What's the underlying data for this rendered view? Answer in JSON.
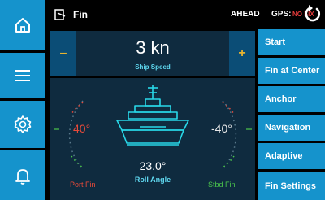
{
  "header": {
    "title": "Fin",
    "mode": "AHEAD",
    "gps_label": "GPS:",
    "gps_status": "NO FIX"
  },
  "sidebar": {
    "items": [
      {
        "icon": "home-icon"
      },
      {
        "icon": "menu-icon"
      },
      {
        "icon": "gear-icon"
      },
      {
        "icon": "bell-icon"
      }
    ]
  },
  "speed": {
    "minus": "–",
    "plus": "+",
    "value": "3 kn",
    "label": "Ship Speed"
  },
  "fins": {
    "port_angle": "40°",
    "stbd_angle": "-40°",
    "port_label": "Port Fin",
    "stbd_label": "Stbd Fin"
  },
  "roll": {
    "value": "23.0°",
    "label": "Roll Angle"
  },
  "menu": {
    "items": [
      {
        "label": "Start"
      },
      {
        "label": "Fin at Center"
      },
      {
        "label": "Anchor"
      },
      {
        "label": "Navigation"
      },
      {
        "label": "Adaptive"
      },
      {
        "label": "Fin Settings"
      }
    ]
  },
  "colors": {
    "accent": "#1593cc",
    "panel": "#0f2b3f",
    "cyan": "#5fd8f0",
    "port": "#e84a3a",
    "stbd": "#4cc84c",
    "yellow": "#e8b430"
  }
}
